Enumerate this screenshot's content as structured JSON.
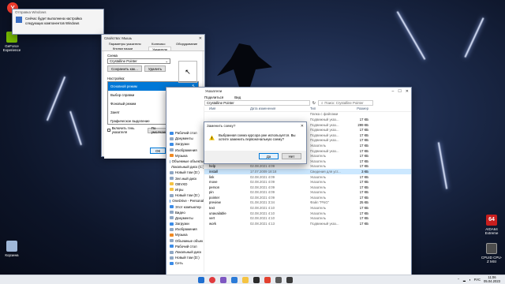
{
  "desktop": {
    "icons": [
      {
        "label": "Yandex",
        "color": "#f03c2e"
      },
      {
        "label": "GeForce Experience",
        "color": "#76b900"
      },
      {
        "label": "Корзина",
        "color": "#9fb7d8"
      }
    ],
    "aida": {
      "label": "AIDA64 Extreme",
      "tag": "64"
    },
    "cpuz": {
      "label": "CPUID CPU-Z MSI"
    }
  },
  "notification": {
    "title": "Отправка Windows",
    "message": "Сейчас будет выполнена настройка следующих компонентов Windows"
  },
  "mouse_dialog": {
    "title": "Свойства: Мышь",
    "tabs_row1": [
      "Параметры указателя",
      "Колесико",
      "Оборудование"
    ],
    "tabs_row2": [
      "Кнопки мыши",
      "Указатели"
    ],
    "scheme_label": "Схема",
    "scheme_value": "Crystalline Pointer",
    "save_as": "Сохранить как...",
    "delete": "Удалить",
    "settings_label": "Настройка:",
    "cursors": [
      {
        "label": "Основной режим",
        "selected": true
      },
      {
        "label": "Выбор справки",
        "selected": false
      },
      {
        "label": "Фоновый режим",
        "selected": false
      },
      {
        "label": "Занят",
        "selected": false
      },
      {
        "label": "Графическое выделение",
        "selected": false
      }
    ],
    "shadow_label": "Включить тень указателя",
    "default_btn": "По умолчанию",
    "browse_btn": "Обзор...",
    "ok": "ОК",
    "cancel": "Отмена",
    "apply": "Применить"
  },
  "explorer": {
    "title": "Указатели",
    "menu": [
      "Поделиться",
      "Вид"
    ],
    "path": "Crystalline Pointer",
    "search_placeholder": "Поиск: Crystalline Pointer",
    "columns": [
      "Имя",
      "Дата изменения",
      "Тип",
      "Размер"
    ],
    "nav": [
      {
        "label": "Рабочий стол",
        "color": "#3c8ce7"
      },
      {
        "label": "Документы",
        "color": "#8fa7c4"
      },
      {
        "label": "Загрузки",
        "color": "#3c8ce7"
      },
      {
        "label": "Изображения",
        "color": "#8fa7c4"
      },
      {
        "label": "Музыка",
        "color": "#f08a24"
      },
      {
        "label": "Объемные объекты",
        "color": "#8fa7c4"
      },
      {
        "label": "Локальный диск (C:)",
        "color": "#8fa7c4"
      },
      {
        "label": "Новый том (D:)",
        "color": "#8fa7c4"
      },
      {
        "label": "Зел.ный диск",
        "color": "#8fa7c4"
      },
      {
        "label": "OBVXD",
        "color": "#f5c342"
      },
      {
        "label": "Игры",
        "color": "#f5c342"
      },
      {
        "label": "Новый том (D:)",
        "color": "#8fa7c4"
      },
      {
        "label": "OneDrive - Personal",
        "color": "#3c8ce7"
      },
      {
        "label": "Этот компьютер",
        "color": "#3c8ce7"
      },
      {
        "label": "Видео",
        "color": "#8fa7c4"
      },
      {
        "label": "Документы",
        "color": "#8fa7c4"
      },
      {
        "label": "Загрузки",
        "color": "#3c8ce7"
      },
      {
        "label": "Изображения",
        "color": "#8fa7c4"
      },
      {
        "label": "Музыка",
        "color": "#f08a24"
      },
      {
        "label": "Объемные объек",
        "color": "#8fa7c4"
      },
      {
        "label": "Рабочий стол",
        "color": "#3c8ce7"
      },
      {
        "label": "Локальный диск",
        "color": "#8fa7c4"
      },
      {
        "label": "Новый том (D:)",
        "color": "#8fa7c4"
      },
      {
        "label": "Сеть",
        "color": "#3c8ce7"
      }
    ],
    "rows": [
      {
        "name": "",
        "date": "",
        "type": "Папка с файлами",
        "size": ""
      },
      {
        "name": "",
        "date": "",
        "type": "Подвижный указ...",
        "size": "17 КБ"
      },
      {
        "name": "",
        "date": "",
        "type": "Подвижный указ...",
        "size": "299 КБ"
      },
      {
        "name": "",
        "date": "",
        "type": "Подвижный указ...",
        "size": "17 КБ"
      },
      {
        "name": "",
        "date": "",
        "type": "Подвижный указ...",
        "size": "17 КБ"
      },
      {
        "name": "",
        "date": "",
        "type": "Подвижный указ...",
        "size": "17 КБ"
      },
      {
        "name": "",
        "date": "",
        "type": "Указатель",
        "size": "17 КБ"
      },
      {
        "name": "",
        "date": "",
        "type": "Подвижный указ...",
        "size": "17 КБ"
      },
      {
        "name": "",
        "date": "",
        "type": "Указатель",
        "size": "17 КБ"
      },
      {
        "name": "",
        "date": "",
        "type": "Указатель",
        "size": "17 КБ"
      },
      {
        "name": "help",
        "date": "02.08.2021 4:09",
        "type": "Указатель",
        "size": "17 КБ"
      },
      {
        "name": "install",
        "date": "17.07.2009 18:18",
        "type": "Сведения для уст...",
        "size": "3 КБ"
      },
      {
        "name": "link",
        "date": "02.08.2021 4:09",
        "type": "Указатель",
        "size": "17 КБ"
      },
      {
        "name": "move",
        "date": "02.08.2021 4:09",
        "type": "Указатель",
        "size": "17 КБ"
      },
      {
        "name": "person",
        "date": "02.08.2021 4:09",
        "type": "Указатель",
        "size": "17 КБ"
      },
      {
        "name": "pin",
        "date": "02.08.2021 4:09",
        "type": "Указатель",
        "size": "17 КБ"
      },
      {
        "name": "pointer",
        "date": "02.08.2021 4:09",
        "type": "Указатель",
        "size": "17 КБ"
      },
      {
        "name": "preview",
        "date": "01.08.2021 3:34",
        "type": "Файл \"PNG\"",
        "size": "25 КБ"
      },
      {
        "name": "text",
        "date": "02.08.2021 4:10",
        "type": "Указатель",
        "size": "17 КБ"
      },
      {
        "name": "unavailable",
        "date": "02.08.2021 4:10",
        "type": "Указатель",
        "size": "17 КБ"
      },
      {
        "name": "vert",
        "date": "02.08.2021 4:10",
        "type": "Указатель",
        "size": "17 КБ"
      },
      {
        "name": "work",
        "date": "02.08.2021 4:13",
        "type": "Подвижный указ...",
        "size": "17 КБ"
      }
    ],
    "status": "Элементов: 20   Выбран 1 элемент: 2,78 КБ"
  },
  "confirm": {
    "title": "Заменить схему?",
    "message": "Выбранная схема курсора уже используется. Вы хотите заменить первоначальную схему?",
    "yes": "Да",
    "no": "Нет"
  },
  "taskbar": {
    "time": "11:06",
    "date": "05.04.2023",
    "lang": "РУС"
  }
}
